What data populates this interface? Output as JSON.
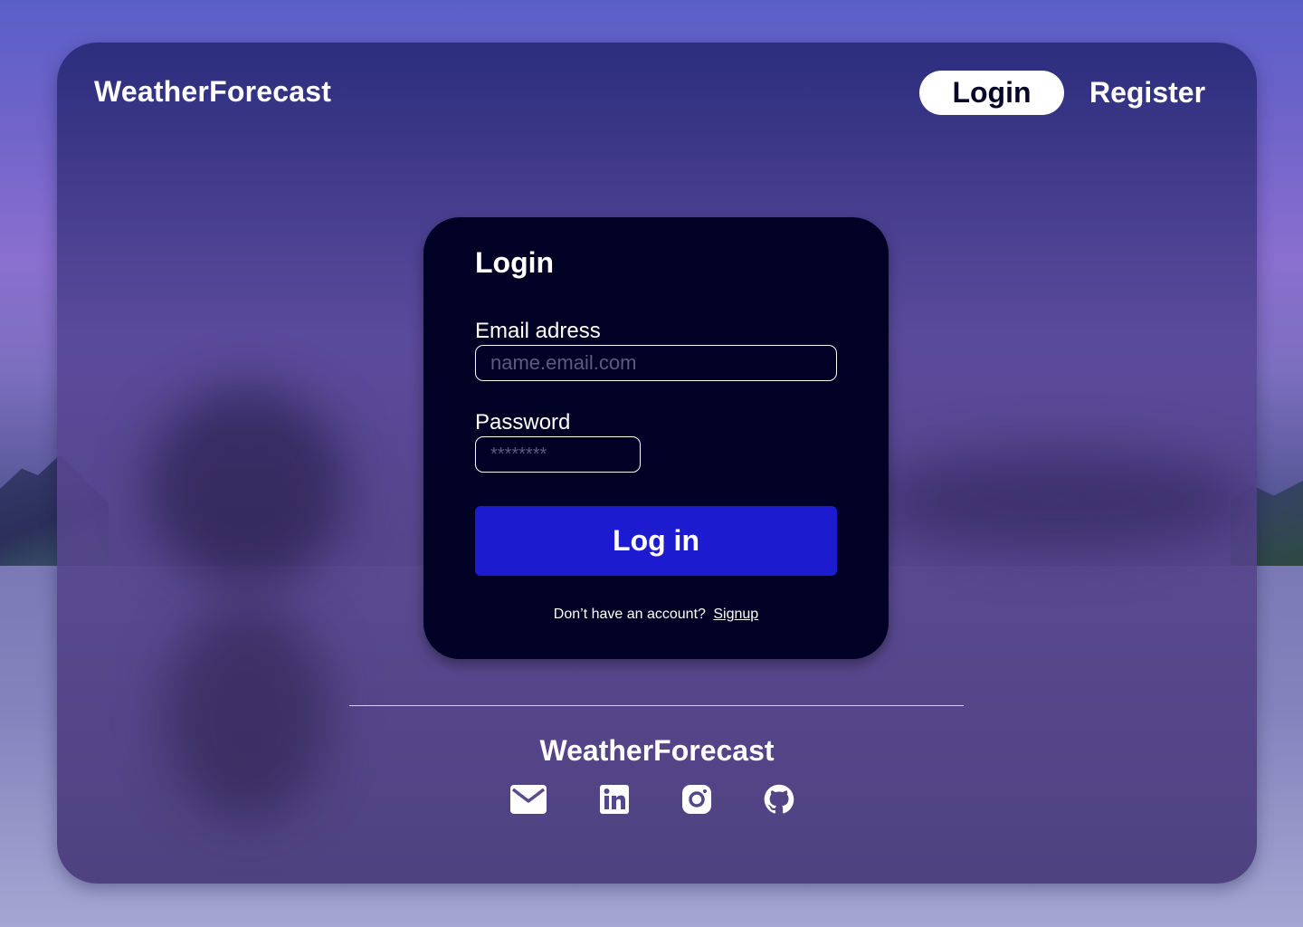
{
  "header": {
    "brand": "WeatherForecast",
    "nav": {
      "login_label": "Login",
      "register_label": "Register"
    }
  },
  "login_card": {
    "title": "Login",
    "email": {
      "label": "Email adress",
      "placeholder": "name.email.com"
    },
    "password": {
      "label": "Password",
      "placeholder": "********"
    },
    "submit_label": "Log in",
    "signup_prompt": "Don’t have an account?",
    "signup_link": "Signup"
  },
  "footer": {
    "brand": "WeatherForecast",
    "social_icons": [
      "mail-icon",
      "linkedin-icon",
      "instagram-icon",
      "github-icon"
    ]
  },
  "colors": {
    "card_background": "#010126",
    "primary_button": "#1c1bd0",
    "text": "#ffffff"
  }
}
